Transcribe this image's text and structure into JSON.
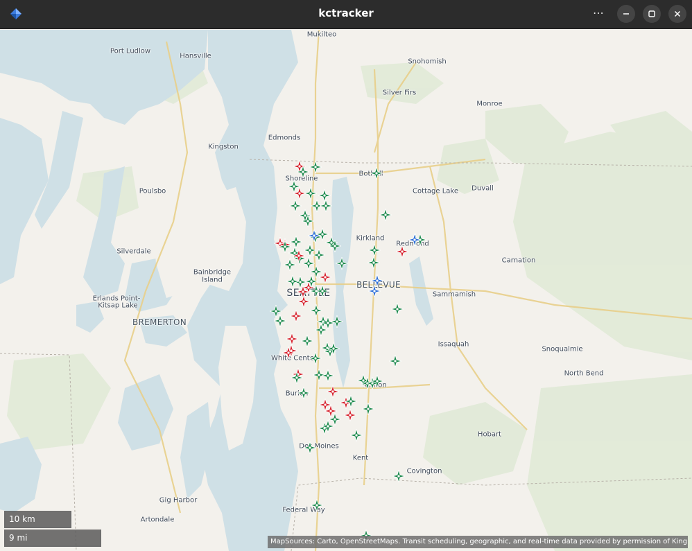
{
  "window": {
    "title": "kctracker",
    "menu_icon": "ellipsis-icon",
    "controls": [
      "minimize-icon",
      "maximize-icon",
      "close-icon"
    ]
  },
  "map": {
    "places": [
      {
        "id": "mukilteo",
        "label": "Mukilteo"
      },
      {
        "id": "port-ludlow",
        "label": "Port Ludlow"
      },
      {
        "id": "hansville",
        "label": "Hansville"
      },
      {
        "id": "snohomish",
        "label": "Snohomish"
      },
      {
        "id": "silver-firs",
        "label": "Silver Firs"
      },
      {
        "id": "monroe",
        "label": "Monroe"
      },
      {
        "id": "edmonds",
        "label": "Edmonds"
      },
      {
        "id": "kingston",
        "label": "Kingston"
      },
      {
        "id": "bothell",
        "label": "Bothell"
      },
      {
        "id": "shoreline",
        "label": "Shoreline"
      },
      {
        "id": "cottage-lake",
        "label": "Cottage Lake"
      },
      {
        "id": "duvall",
        "label": "Duvall"
      },
      {
        "id": "poulsbo",
        "label": "Poulsbo"
      },
      {
        "id": "kirkland",
        "label": "Kirkland"
      },
      {
        "id": "redmond",
        "label": "Redmond"
      },
      {
        "id": "silverdale",
        "label": "Silverdale"
      },
      {
        "id": "carnation",
        "label": "Carnation"
      },
      {
        "id": "bainbridge",
        "label": "Bainbridge"
      },
      {
        "id": "island",
        "label": "Island"
      },
      {
        "id": "bellevue",
        "label": "BELLEVUE"
      },
      {
        "id": "seattle",
        "label": "SEATTLE"
      },
      {
        "id": "sammamish",
        "label": "Sammamish"
      },
      {
        "id": "erlands",
        "label": "Erlands Point-"
      },
      {
        "id": "kitsap-lake",
        "label": "Kitsap Lake"
      },
      {
        "id": "bremerton",
        "label": "BREMERTON"
      },
      {
        "id": "issaquah",
        "label": "Issaquah"
      },
      {
        "id": "snoqualmie",
        "label": "Snoqualmie"
      },
      {
        "id": "white-center",
        "label": "White Center"
      },
      {
        "id": "north-bend",
        "label": "North Bend"
      },
      {
        "id": "renton",
        "label": "Renton"
      },
      {
        "id": "burien",
        "label": "Burien"
      },
      {
        "id": "hobart",
        "label": "Hobart"
      },
      {
        "id": "des-moines",
        "label": "Des Moines"
      },
      {
        "id": "kent",
        "label": "Kent"
      },
      {
        "id": "covington",
        "label": "Covington"
      },
      {
        "id": "gig-harbor",
        "label": "Gig Harbor"
      },
      {
        "id": "artondale",
        "label": "Artondale"
      },
      {
        "id": "federal-way",
        "label": "Federal Way"
      }
    ],
    "marker_colors": {
      "green": "#1e8a4e",
      "red": "#d6232e",
      "blue": "#2f6fd8"
    },
    "vehicle_markers": [
      {
        "color": "red"
      },
      {
        "color": "green"
      },
      {
        "color": "green"
      },
      {
        "color": "green"
      },
      {
        "color": "green"
      },
      {
        "color": "red"
      },
      {
        "color": "green"
      },
      {
        "color": "green"
      },
      {
        "color": "green"
      },
      {
        "color": "green"
      },
      {
        "color": "green"
      },
      {
        "color": "green"
      },
      {
        "color": "green"
      },
      {
        "color": "green"
      },
      {
        "color": "green"
      },
      {
        "color": "green"
      },
      {
        "color": "blue"
      },
      {
        "color": "green"
      },
      {
        "color": "green"
      },
      {
        "color": "red"
      },
      {
        "color": "red"
      },
      {
        "color": "green"
      },
      {
        "color": "green"
      },
      {
        "color": "green"
      },
      {
        "color": "green"
      },
      {
        "color": "green"
      },
      {
        "color": "green"
      },
      {
        "color": "red"
      },
      {
        "color": "green"
      },
      {
        "color": "green"
      },
      {
        "color": "green"
      },
      {
        "color": "green"
      },
      {
        "color": "green"
      },
      {
        "color": "green"
      },
      {
        "color": "red"
      },
      {
        "color": "green"
      },
      {
        "color": "green"
      },
      {
        "color": "red"
      },
      {
        "color": "red"
      },
      {
        "color": "red"
      },
      {
        "color": "green"
      },
      {
        "color": "green"
      },
      {
        "color": "red"
      },
      {
        "color": "green"
      },
      {
        "color": "blue"
      },
      {
        "color": "blue"
      },
      {
        "color": "green"
      },
      {
        "color": "blue"
      },
      {
        "color": "green"
      },
      {
        "color": "green"
      },
      {
        "color": "green"
      },
      {
        "color": "red"
      },
      {
        "color": "green"
      },
      {
        "color": "green"
      },
      {
        "color": "green"
      },
      {
        "color": "green"
      },
      {
        "color": "green"
      },
      {
        "color": "red"
      },
      {
        "color": "green"
      },
      {
        "color": "red"
      },
      {
        "color": "red"
      },
      {
        "color": "green"
      },
      {
        "color": "green"
      },
      {
        "color": "green"
      },
      {
        "color": "green"
      },
      {
        "color": "red"
      },
      {
        "color": "green"
      },
      {
        "color": "green"
      },
      {
        "color": "green"
      },
      {
        "color": "green"
      },
      {
        "color": "green"
      },
      {
        "color": "green"
      },
      {
        "color": "green"
      },
      {
        "color": "green"
      },
      {
        "color": "red"
      },
      {
        "color": "red"
      },
      {
        "color": "red"
      },
      {
        "color": "green"
      },
      {
        "color": "green"
      },
      {
        "color": "red"
      },
      {
        "color": "green"
      },
      {
        "color": "green"
      },
      {
        "color": "green"
      },
      {
        "color": "green"
      },
      {
        "color": "red"
      },
      {
        "color": "green"
      },
      {
        "color": "green"
      },
      {
        "color": "green"
      },
      {
        "color": "green"
      },
      {
        "color": "green"
      },
      {
        "color": "green"
      }
    ],
    "scale": {
      "km_label": "10 km",
      "mi_label": "9 mi"
    },
    "attribution": "MapSources: Carto, OpenStreetMaps. Transit scheduling, geographic, and real-time data provided by permission of King County"
  }
}
